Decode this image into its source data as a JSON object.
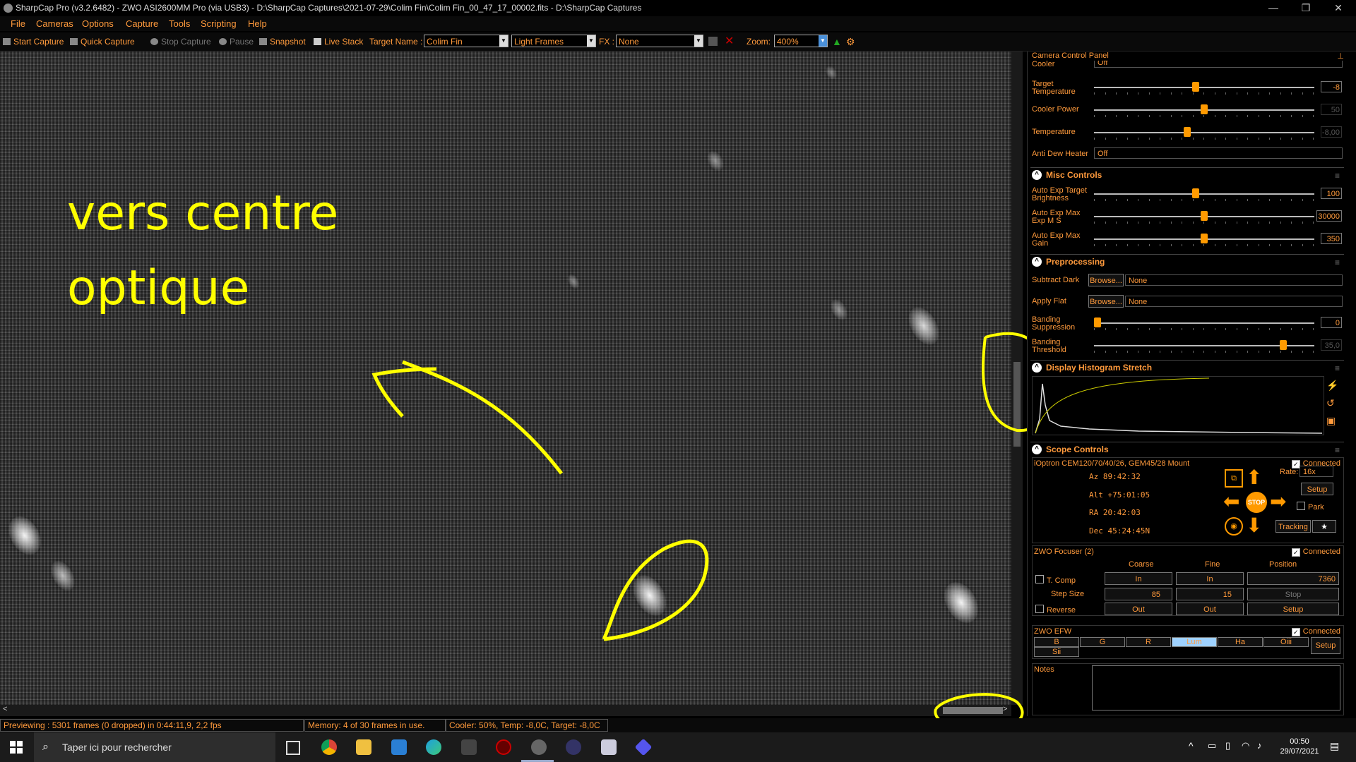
{
  "window": {
    "title": "SharpCap Pro (v3.2.6482) - ZWO ASI2600MM Pro (via USB3) - D:\\SharpCap Captures\\2021-07-29\\Colim Fin\\Colim Fin_00_47_17_00002.fits - D:\\SharpCap Captures",
    "minimize": "—",
    "maximize": "❐",
    "close": "✕"
  },
  "menu": [
    "File",
    "Cameras",
    "Options",
    "Capture",
    "Tools",
    "Scripting",
    "Help"
  ],
  "toolbar": {
    "start_capture": "Start Capture",
    "quick_capture": "Quick Capture",
    "stop_capture": "Stop Capture",
    "pause": "Pause",
    "snapshot": "Snapshot",
    "live_stack": "Live Stack",
    "target_name_label": "Target Name :",
    "target_name_value": "Colim Fin",
    "frame_type": "Light Frames",
    "fx_label": "FX :",
    "fx_value": "None",
    "zoom_label": "Zoom:",
    "zoom_value": "400%"
  },
  "annotation": {
    "line1": "vers centre",
    "line2": "optique"
  },
  "status": {
    "preview": "Previewing : 5301 frames (0 dropped) in 0:44:11,9, 2,2 fps",
    "memory": "Memory: 4 of 30 frames in use.",
    "cooler": "Cooler: 50%, Temp: -8,0C, Target: -8,0C"
  },
  "panel": {
    "title": "Camera Control Panel",
    "cooler_label": "Cooler",
    "cooler_value": "Off",
    "target_temp_label": "Target Temperature",
    "target_temp_value": "-8",
    "target_temp_level": 0.46,
    "cooler_power_label": "Cooler Power",
    "cooler_power_value": "50",
    "cooler_power_level": 0.5,
    "temperature_label": "Temperature",
    "temperature_value": "-8,00",
    "temperature_level": 0.42,
    "anti_dew_label": "Anti Dew Heater",
    "anti_dew_value": "Off",
    "misc_title": "Misc Controls",
    "ae_target_label": "Auto Exp Target Brightness",
    "ae_target_value": "100",
    "ae_target_level": 0.46,
    "ae_maxexp_label": "Auto Exp Max Exp M S",
    "ae_maxexp_value": "30000",
    "ae_maxexp_level": 0.5,
    "ae_maxgain_label": "Auto Exp Max Gain",
    "ae_maxgain_value": "350",
    "ae_maxgain_level": 0.5,
    "pre_title": "Preprocessing",
    "subtract_dark_label": "Subtract Dark",
    "apply_flat_label": "Apply Flat",
    "browse": "Browse...",
    "none": "None",
    "banding_supp_label": "Banding Suppression",
    "banding_supp_value": "0",
    "banding_supp_level": 0.0,
    "banding_thr_label": "Banding Threshold",
    "banding_thr_value": "35,0",
    "banding_thr_level": 0.87,
    "hist_title": "Display Histogram Stretch",
    "scope_title": "Scope Controls",
    "mount_name": "iOptron CEM120/70/40/26, GEM45/28 Mount",
    "connected": "Connected",
    "az": "Az  89:42:32",
    "alt": "Alt +75:01:05",
    "ra": "RA  20:42:03",
    "dec": "Dec 45:24:45N",
    "rate_label": "Rate:",
    "rate_value": "16x",
    "setup": "Setup",
    "park": "Park",
    "tracking": "Tracking",
    "stop": "STOP",
    "focuser_title": "ZWO Focuser (2)",
    "coarse": "Coarse",
    "fine": "Fine",
    "position": "Position",
    "tcomp": "T. Comp",
    "in": "In",
    "out": "Out",
    "position_value": "7360",
    "step_size": "Step Size",
    "coarse_step": "85",
    "fine_step": "15",
    "stop_btn": "Stop",
    "reverse": "Reverse",
    "efw_title": "ZWO EFW",
    "filters": [
      "B",
      "G",
      "R",
      "Lum",
      "Ha",
      "Oiii",
      "Sii"
    ],
    "selected_filter": "Lum",
    "notes_label": "Notes"
  },
  "taskbar": {
    "search_placeholder": "Taper ici pour rechercher",
    "time": "00:50",
    "date": "29/07/2021"
  }
}
